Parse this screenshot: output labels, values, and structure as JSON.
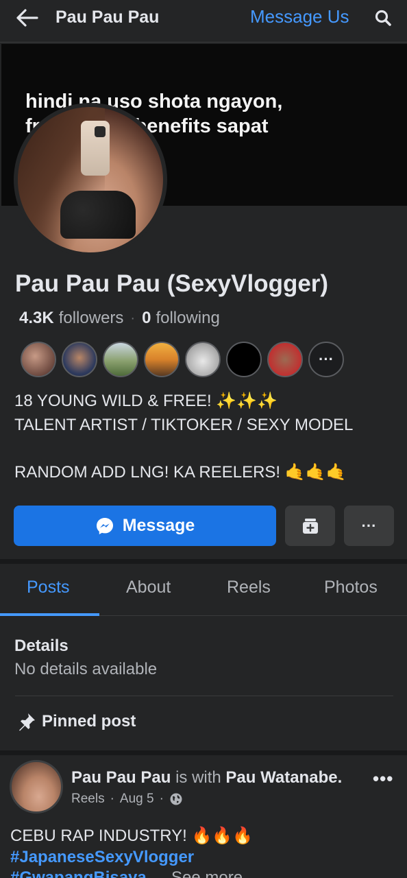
{
  "topbar": {
    "title": "Pau Pau Pau",
    "message_link": "Message Us",
    "icons": [
      "back-arrow-icon",
      "search-icon"
    ]
  },
  "cover": {
    "line1": "hindi na uso shota ngayon,",
    "line2": "fr              h benefits sapat"
  },
  "profile": {
    "name": "Pau Pau Pau (SexyVlogger)",
    "followers_count": "4.3K",
    "followers_label": "followers",
    "following_count": "0",
    "following_label": "following",
    "more_friends_label": "···",
    "bio": "18 YOUNG WILD & FREE! ✨✨✨\nTALENT ARTIST / TIKTOKER / SEXY MODEL\n\nRANDOM ADD LNG! KA REELERS! 🤙🤙🤙"
  },
  "actions": {
    "message_label": "Message",
    "more_label": "···",
    "icons": [
      "messenger-icon",
      "save-profile-icon"
    ]
  },
  "tabs": [
    {
      "label": "Posts",
      "active": true
    },
    {
      "label": "About",
      "active": false
    },
    {
      "label": "Reels",
      "active": false
    },
    {
      "label": "Photos",
      "active": false
    }
  ],
  "details": {
    "title": "Details",
    "text": "No details available"
  },
  "pinned": {
    "label": "Pinned post"
  },
  "post": {
    "author": "Pau Pau Pau",
    "with_text": "is with",
    "tagged": "Pau Watanabe.",
    "source": "Reels",
    "date": "Aug 5",
    "more_label": "•••",
    "text": "CEBU RAP INDUSTRY! 🔥🔥🔥",
    "hashtag1": "#JapaneseSexyVlogger",
    "hashtag2": "#GwapangBisaya",
    "see_more": "See more"
  },
  "colors": {
    "background": "#242526",
    "accent": "#4599ff",
    "button_blue": "#1b74e4"
  }
}
